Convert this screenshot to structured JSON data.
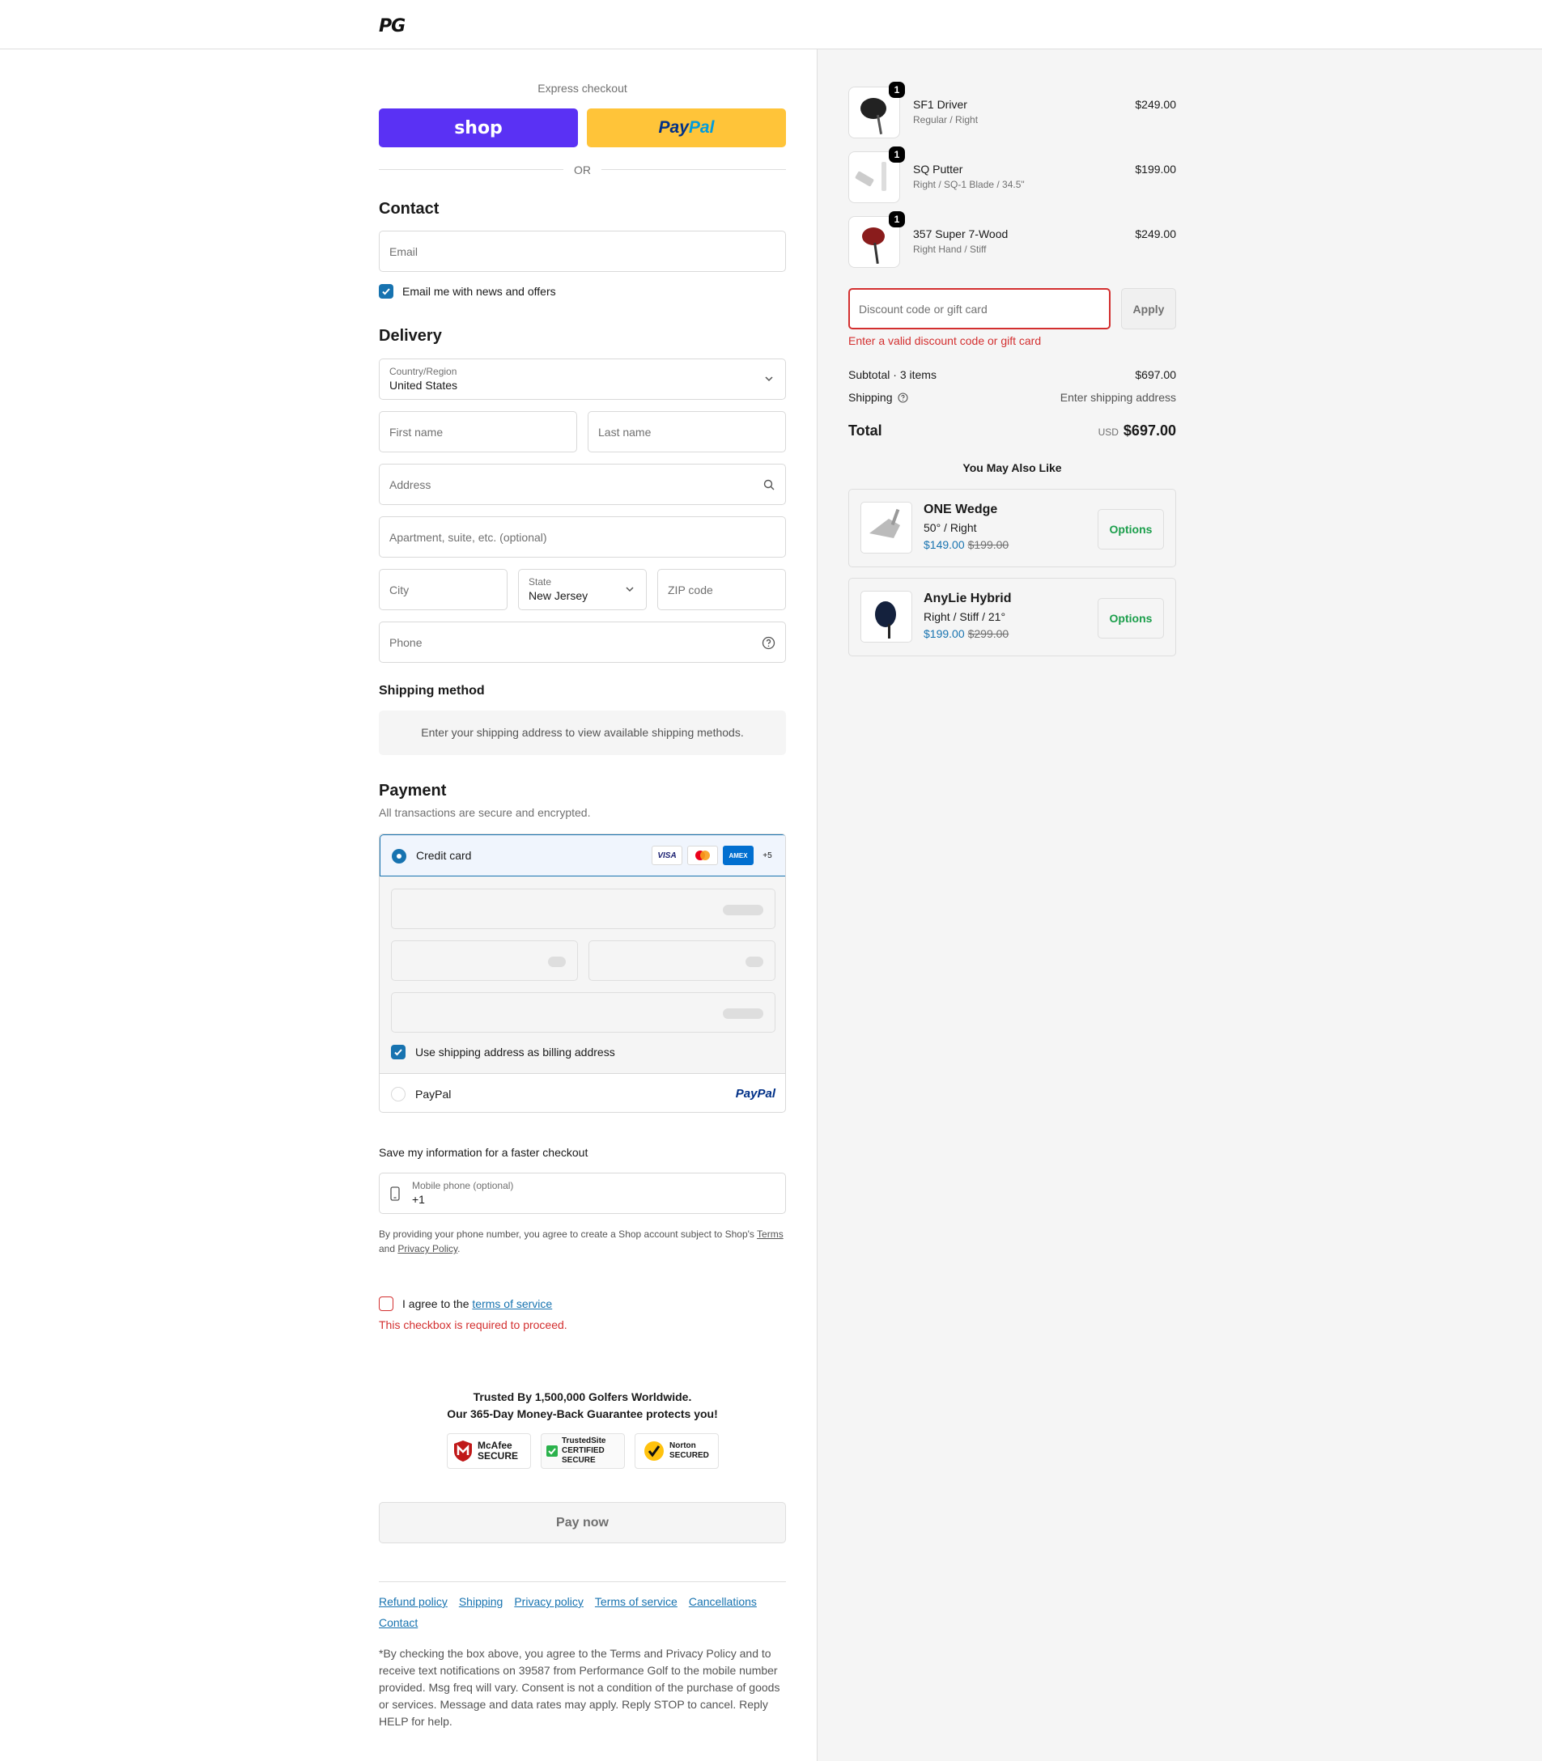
{
  "header": {
    "logo": "PG"
  },
  "express": {
    "title": "Express checkout",
    "shop_label": "shop",
    "paypal_label_1": "Pay",
    "paypal_label_2": "Pal",
    "or_label": "OR"
  },
  "contact": {
    "title": "Contact",
    "email_placeholder": "Email",
    "news_label": "Email me with news and offers"
  },
  "delivery": {
    "title": "Delivery",
    "country_label": "Country/Region",
    "country_value": "United States",
    "first_name_placeholder": "First name",
    "last_name_placeholder": "Last name",
    "address_placeholder": "Address",
    "apartment_placeholder": "Apartment, suite, etc. (optional)",
    "city_placeholder": "City",
    "state_label": "State",
    "state_value": "New Jersey",
    "zip_placeholder": "ZIP code",
    "phone_placeholder": "Phone"
  },
  "shipping_method": {
    "title": "Shipping method",
    "message": "Enter your shipping address to view available shipping methods."
  },
  "payment": {
    "title": "Payment",
    "subtitle": "All transactions are secure and encrypted.",
    "credit_card_label": "Credit card",
    "card_brands": [
      "VISA",
      "Mastercard",
      "AMEX"
    ],
    "more_brands": "+5",
    "billing_label": "Use shipping address as billing address",
    "paypal_option_label": "PayPal",
    "paypal_logo": "PayPal"
  },
  "save_info": {
    "title": "Save my information for a faster checkout",
    "mobile_label": "Mobile phone (optional)",
    "mobile_value": "+1",
    "legal_prefix": "By providing your phone number, you agree to create a Shop account subject to Shop's ",
    "terms_link": "Terms",
    "legal_and": " and ",
    "privacy_link": "Privacy Policy",
    "legal_suffix": "."
  },
  "agree": {
    "prefix": "I agree to the ",
    "link": "terms of service",
    "error": "This checkbox is required to proceed."
  },
  "trust": {
    "line1": "Trusted By 1,500,000 Golfers Worldwide.",
    "line2": "Our 365-Day Money-Back Guarantee protects you!",
    "badges": [
      "McAfee SECURE",
      "TrustedSite CERTIFIED SECURE",
      "Norton SECURED"
    ]
  },
  "pay_now": "Pay now",
  "footer": {
    "links": [
      "Refund policy",
      "Shipping",
      "Privacy policy",
      "Terms of service",
      "Cancellations",
      "Contact"
    ],
    "disclaimer": "*By checking the box above, you agree to the Terms and Privacy Policy and to receive text notifications on 39587 from Performance Golf to the mobile number provided. Msg freq will vary. Consent is not a condition of the purchase of goods or services. Message and data rates may apply. Reply STOP to cancel. Reply HELP for help."
  },
  "cart": {
    "items": [
      {
        "name": "SF1 Driver",
        "variant": "Regular / Right",
        "price": "$249.00",
        "qty": "1"
      },
      {
        "name": "SQ Putter",
        "variant": "Right / SQ-1 Blade / 34.5\"",
        "price": "$199.00",
        "qty": "1"
      },
      {
        "name": "357 Super 7-Wood",
        "variant": "Right Hand / Stiff",
        "price": "$249.00",
        "qty": "1"
      }
    ],
    "discount_placeholder": "Discount code or gift card",
    "apply_label": "Apply",
    "discount_error": "Enter a valid discount code or gift card",
    "subtotal_label": "Subtotal · 3 items",
    "subtotal_value": "$697.00",
    "shipping_label": "Shipping",
    "shipping_value": "Enter shipping address",
    "total_label": "Total",
    "currency": "USD",
    "total_value": "$697.00"
  },
  "recommend": {
    "title": "You May Also Like",
    "items": [
      {
        "name": "ONE Wedge",
        "variant": "50° / Right",
        "price": "$149.00",
        "old_price": "$199.00",
        "button": "Options"
      },
      {
        "name": "AnyLie Hybrid",
        "variant": "Right / Stiff / 21°",
        "price": "$199.00",
        "old_price": "$299.00",
        "button": "Options"
      }
    ]
  },
  "colors": {
    "accent": "#1773b0",
    "error": "#d32f2f",
    "shop": "#5a31f4",
    "paypal": "#ffc439",
    "options": "#1b9e4b"
  }
}
